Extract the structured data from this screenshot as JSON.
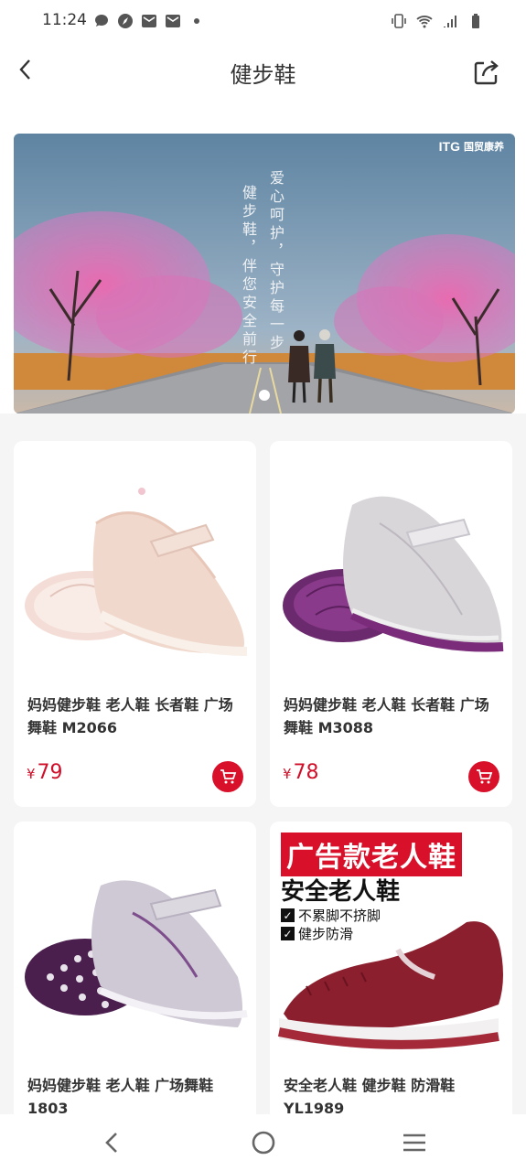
{
  "status": {
    "time": "11:24",
    "left_icons": [
      "message-icon",
      "compass-icon",
      "mail-icon",
      "mail-icon",
      "dot-icon"
    ],
    "right_icons": [
      "vibrate-icon",
      "wifi-icon",
      "signal-icon",
      "battery-icon"
    ]
  },
  "header": {
    "title": "健步鞋",
    "back_icon": "chevron-left-icon",
    "share_icon": "share-icon"
  },
  "banner": {
    "logo_text": "ITG",
    "logo_sub": "国贸康养",
    "slogan_1": "爱心呵护，守护每一步",
    "slogan_2": "健步鞋，伴您安全前行",
    "slides": 1,
    "active_slide": 1
  },
  "products": [
    {
      "title": "妈妈健步鞋 老人鞋 长者鞋 广场舞鞋 M2066",
      "currency": "¥",
      "price": "79"
    },
    {
      "title": "妈妈健步鞋 老人鞋 长者鞋 广场舞鞋 M3088",
      "currency": "¥",
      "price": "78"
    },
    {
      "title": "妈妈健步鞋 老人鞋 广场舞鞋 1803",
      "currency": "¥",
      "price": ""
    },
    {
      "title": "安全老人鞋 健步鞋 防滑鞋 YL1989",
      "currency": "¥",
      "price": "",
      "ad_headline": "广告款老人鞋",
      "ad_subtitle": "安全老人鞋",
      "ad_features": [
        "不累脚不挤脚",
        "健步防滑"
      ]
    }
  ],
  "nav": {
    "back_icon": "triangle-back-icon",
    "home_icon": "circle-home-icon",
    "menu_icon": "menu-icon"
  },
  "colors": {
    "accent": "#d8102a",
    "price": "#d0102a"
  }
}
